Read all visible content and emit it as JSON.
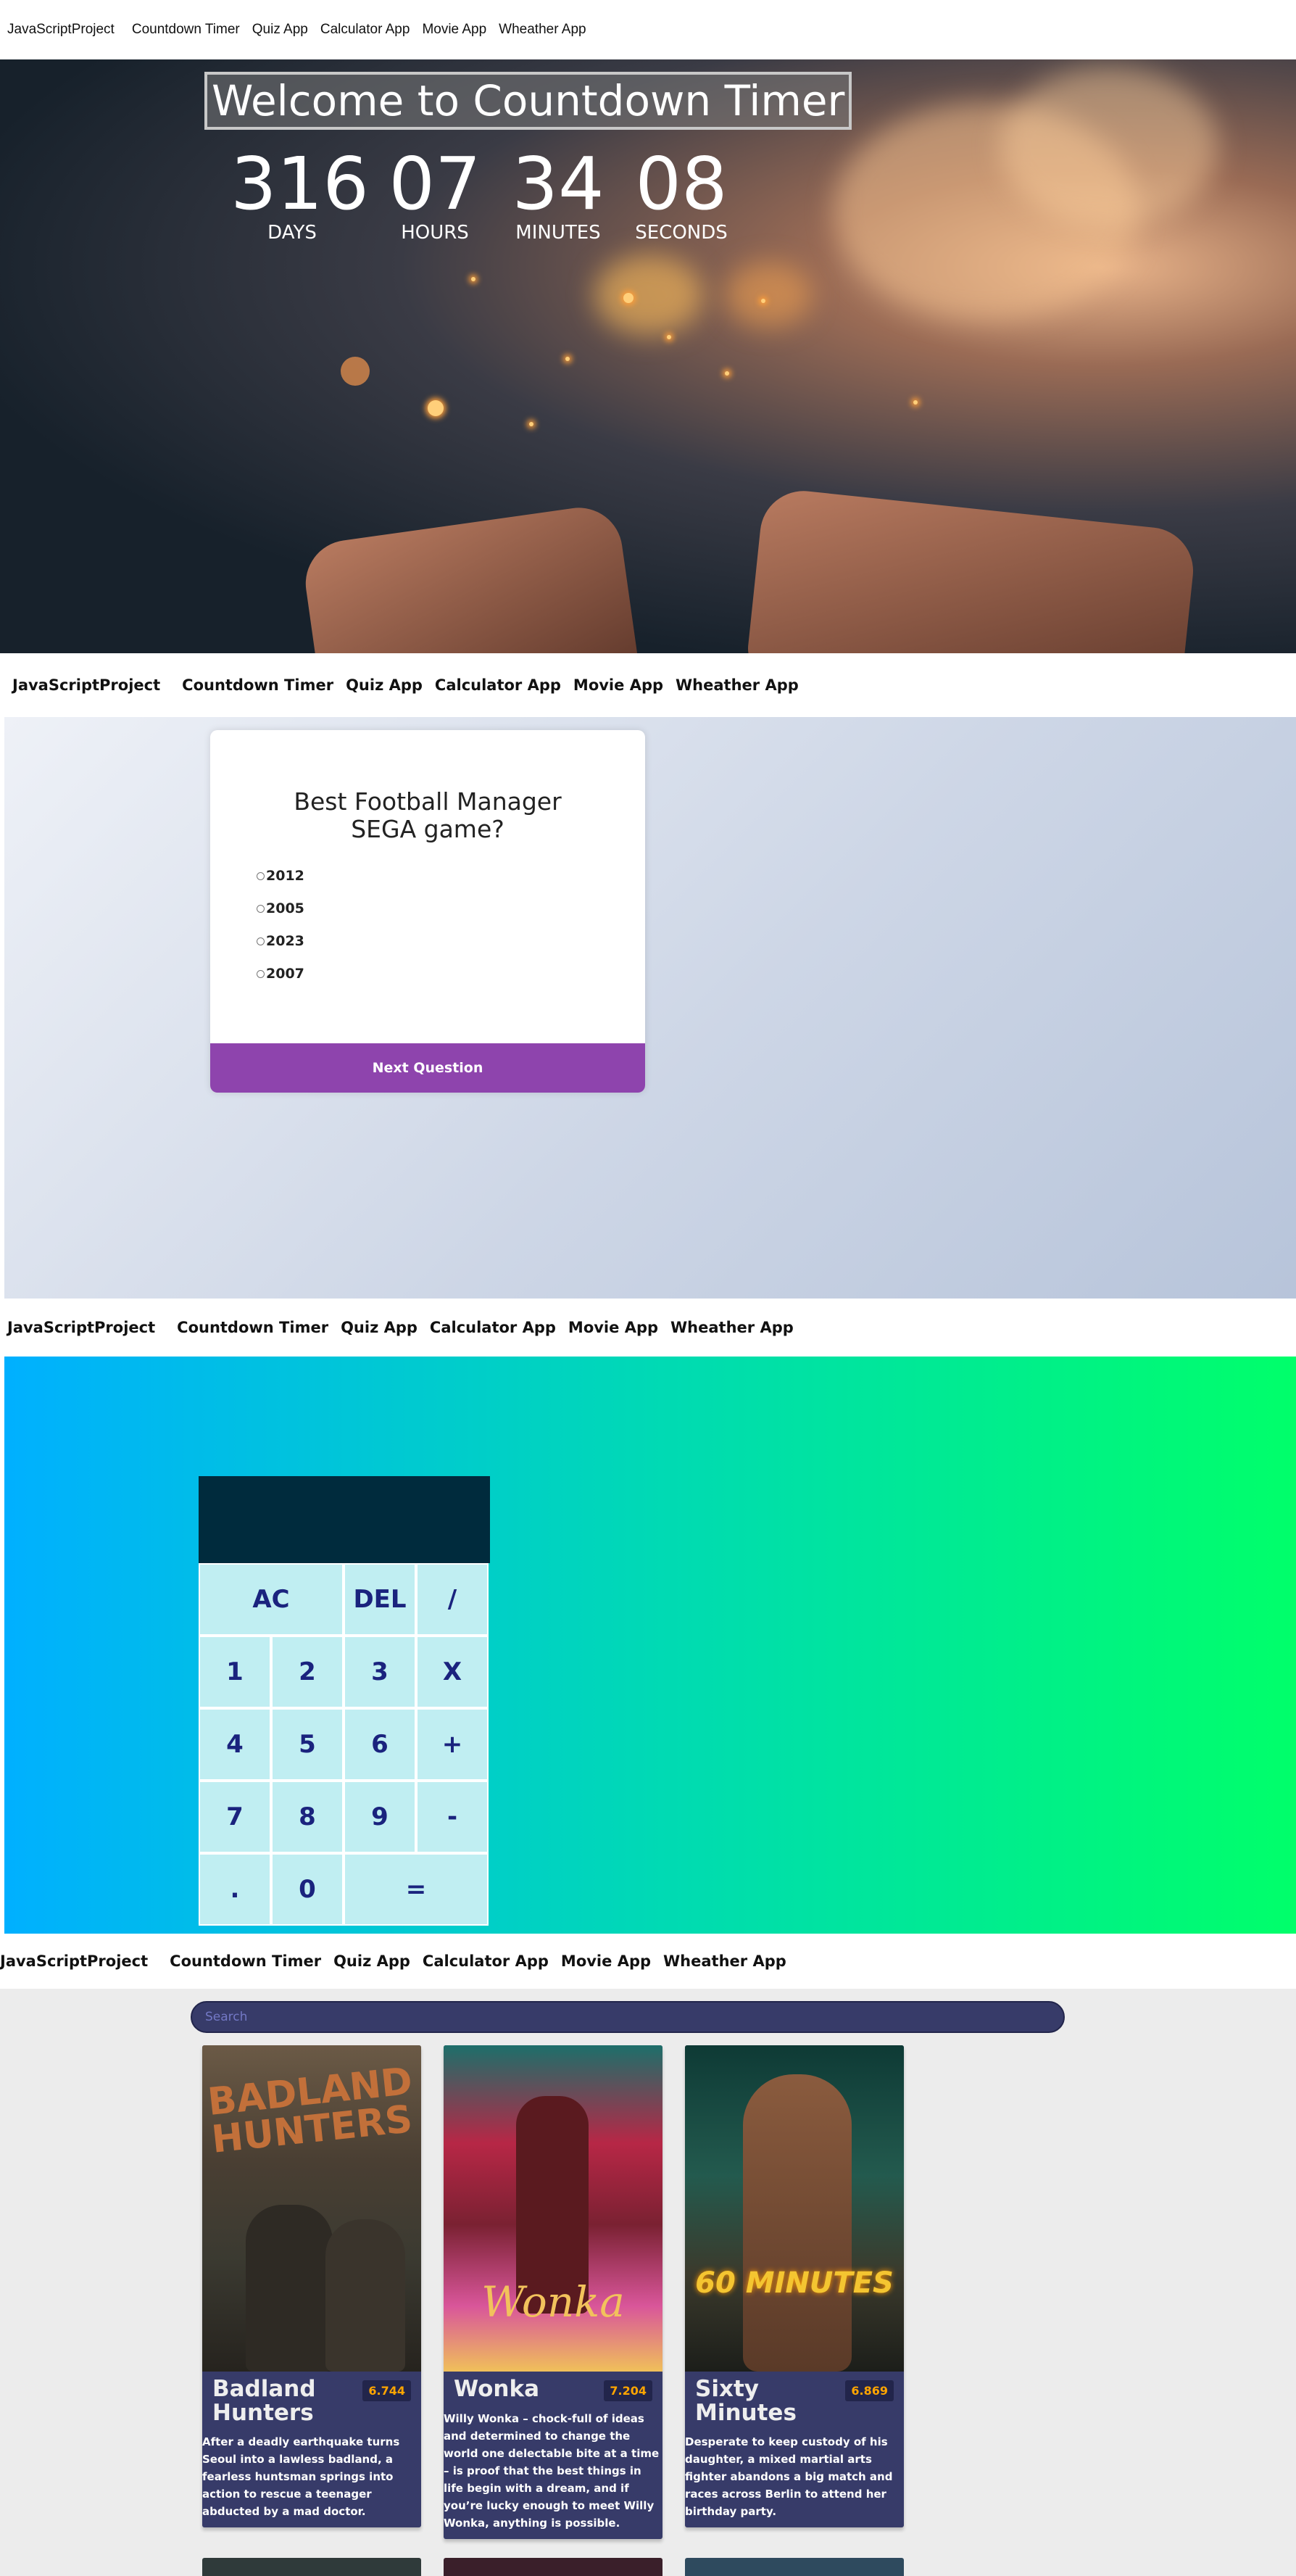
{
  "nav": {
    "brand": "JavaScriptProject",
    "links": [
      "Countdown Timer",
      "Quiz App",
      "Calculator App",
      "Movie App",
      "Wheather App"
    ]
  },
  "countdown": {
    "title": "Welcome to Countdown Timer",
    "units": [
      {
        "value": "316",
        "label": "DAYS"
      },
      {
        "value": "07",
        "label": "HOURS"
      },
      {
        "value": "34",
        "label": "MINUTES"
      },
      {
        "value": "08",
        "label": "SECONDS"
      }
    ]
  },
  "quiz": {
    "question": "Best Football Manager SEGA game?",
    "options": [
      "2012",
      "2005",
      "2023",
      "2007"
    ],
    "button": "Next Question",
    "accent": "#8e44ad"
  },
  "calculator": {
    "display": "",
    "keys": [
      "AC",
      "DEL",
      "/",
      "1",
      "2",
      "3",
      "X",
      "4",
      "5",
      "6",
      "+",
      "7",
      "8",
      "9",
      "-",
      ".",
      "0",
      "="
    ]
  },
  "movies": {
    "search_placeholder": "Search",
    "items": [
      {
        "title": "Badland Hunters",
        "rating": "6.744",
        "poster_text": "BADLAND HUNTERS",
        "overview": "After a deadly earthquake turns Seoul into a lawless badland, a fearless huntsman springs into action to rescue a teenager abducted by a mad doctor."
      },
      {
        "title": "Wonka",
        "rating": "7.204",
        "poster_text": "Wonka",
        "overview": "Willy Wonka – chock-full of ideas and determined to change the world one delectable bite at a time – is proof that the best things in life begin with a dream, and if you’re lucky enough to meet Willy Wonka, anything is possible."
      },
      {
        "title": "Sixty Minutes",
        "rating": "6.869",
        "poster_text": "60 MINUTES",
        "overview": "Desperate to keep custody of his daughter, a mixed martial arts fighter abandons a big match and races across Berlin to attend her birthday party."
      }
    ]
  }
}
